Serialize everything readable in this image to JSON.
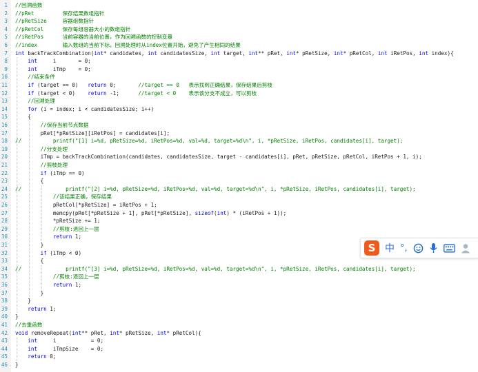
{
  "code": {
    "lines": [
      {
        "n": "1",
        "t": "//回溯函数"
      },
      {
        "n": "2",
        "t": "//pRet         保存结果数组指针"
      },
      {
        "n": "3",
        "t": "//pRetSize     容器组数指针"
      },
      {
        "n": "4",
        "t": "//pRetCol      保存每组容器大小的数组指针"
      },
      {
        "n": "5",
        "t": "//iRetPos      当前容器的当前位置，作为回溯函数的控制变量"
      },
      {
        "n": "6",
        "t": "//index        输入数组的当前下标，回溯处理时从index位置开始，避免了产生相同的结果"
      },
      {
        "n": "7",
        "t": "int backTrackCombination(int* candidates, int candidatesSize, int target, int** pRet, int* pRetSize, int* pRetCol, int iRetPos, int index){"
      },
      {
        "n": "8",
        "t": "    int     i       = 0;"
      },
      {
        "n": "9",
        "t": "    int     iTmp    = 0;"
      },
      {
        "n": "10",
        "t": "    //结束条件"
      },
      {
        "n": "11",
        "t": "    if (target == 0)   return 0;       //target == 0   表示找到正确结果，保存结果后剪枝"
      },
      {
        "n": "12",
        "t": "    if (target < 0)    return -1;      //target < 0    表示该分支不成立，可以剪枝"
      },
      {
        "n": "13",
        "t": "    //回溯处理"
      },
      {
        "n": "14",
        "t": "    for (i = index; i < candidatesSize; i++)"
      },
      {
        "n": "15",
        "t": "    {"
      },
      {
        "n": "16",
        "t": "        //保存当前节点数据"
      },
      {
        "n": "17",
        "t": "        pRet[*pRetSize][iRetPos] = candidates[i];"
      },
      {
        "n": "18",
        "t": "//          printf(\"[1] i=%d, pRetSize=%d, iRetPos=%d, val=%d, target=%d\\n\", i, *pRetSize, iRetPos, candidates[i], target);"
      },
      {
        "n": "19",
        "t": "        //分支处理"
      },
      {
        "n": "20",
        "t": "        iTmp = backTrackCombination(candidates, candidatesSize, target - candidates[i], pRet, pRetSize, pRetCol, iRetPos + 1, i);"
      },
      {
        "n": "21",
        "t": "        //剪枝处理"
      },
      {
        "n": "22",
        "t": "        if (iTmp == 0)"
      },
      {
        "n": "23",
        "t": "        {"
      },
      {
        "n": "24",
        "t": "//              printf(\"[2] i=%d, pRetSize=%d, iRetPos=%d, val=%d, target=%d\\n\", i, *pRetSize, iRetPos, candidates[i], target);"
      },
      {
        "n": "25",
        "t": "            //该结果正确，保存结果"
      },
      {
        "n": "26",
        "t": "            pRetCol[*pRetSize] = iRetPos + 1;"
      },
      {
        "n": "27",
        "t": "            memcpy(pRet[*pRetSize + 1], pRet[*pRetSize], sizeof(int) * (iRetPos + 1));"
      },
      {
        "n": "28",
        "t": "            *pRetSize += 1;"
      },
      {
        "n": "29",
        "t": "            //剪枝:退回上一层"
      },
      {
        "n": "30",
        "t": "            return 1;"
      },
      {
        "n": "31",
        "t": "        }"
      },
      {
        "n": "32",
        "t": "        if (iTmp < 0)"
      },
      {
        "n": "33",
        "t": "        {"
      },
      {
        "n": "34",
        "t": "//              printf(\"[3] i=%d, pRetSize=%d, iRetPos=%d, val=%d, target=%d\\n\", i, *pRetSize, iRetPos, candidates[i], target);"
      },
      {
        "n": "35",
        "t": "            //剪枝:退回上一层"
      },
      {
        "n": "36",
        "t": "            return 1;"
      },
      {
        "n": "37",
        "t": "        }"
      },
      {
        "n": "38",
        "t": "    }"
      },
      {
        "n": "39",
        "t": "    return 1;"
      },
      {
        "n": "40",
        "t": "}"
      },
      {
        "n": "41",
        "t": "//去重函数"
      },
      {
        "n": "42",
        "t": "void removeRepeat(int** pRet, int* pRetSize, int* pRetCol){"
      },
      {
        "n": "43",
        "t": "    int     i           = 0;"
      },
      {
        "n": "44",
        "t": "    int     iTmpSize    = 0;"
      },
      {
        "n": "45",
        "t": "    return 0;"
      },
      {
        "n": "46",
        "t": "}"
      }
    ]
  },
  "ime_toolbar": {
    "logo": "S",
    "mode": "中",
    "punct": "°,",
    "emoji_icon": "smiley-icon",
    "voice_icon": "microphone-icon",
    "keyboard_icon": "keyboard-icon",
    "user_icon": "user-icon",
    "accent_color": "#f05a1a",
    "icon_color": "#2b6fd6"
  }
}
